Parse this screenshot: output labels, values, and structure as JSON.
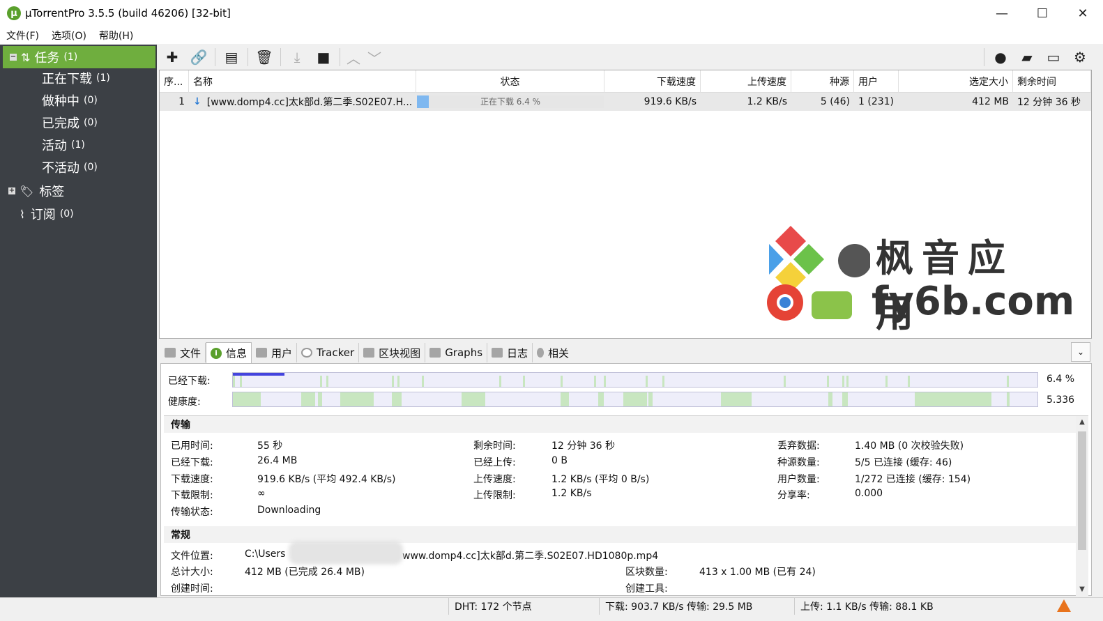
{
  "window": {
    "title": "µTorrentPro 3.5.5  (build 46206) [32-bit]",
    "app_icon_glyph": "µ",
    "minimize_glyph": "—",
    "maximize_glyph": "☐",
    "close_glyph": "✕"
  },
  "menu": [
    "文件(F)",
    "选项(O)",
    "帮助(H)"
  ],
  "sidebar": {
    "tasks": {
      "label": "任务",
      "count": "(1)"
    },
    "items": [
      {
        "label": "正在下载",
        "count": "(1)"
      },
      {
        "label": "做种中",
        "count": "(0)"
      },
      {
        "label": "已完成",
        "count": "(0)"
      },
      {
        "label": "活动",
        "count": "(1)"
      },
      {
        "label": "不活动",
        "count": "(0)"
      }
    ],
    "labels": {
      "label": "标签"
    },
    "feeds": {
      "label": "订阅",
      "count": "(0)"
    }
  },
  "toolbar": {
    "icons": {
      "add": "plus-icon",
      "add_link": "link-icon",
      "create": "new-torrent-icon",
      "remove": "trash-icon",
      "start": "download-icon",
      "stop": "stop-icon",
      "up": "chevron-up-icon",
      "down": "chevron-down-icon",
      "bulb": "bulb-icon",
      "chat": "chat-icon",
      "remote": "monitor-icon",
      "settings": "gear-icon"
    }
  },
  "list": {
    "columns": [
      "序...",
      "名称",
      "状态",
      "下载速度",
      "上传速度",
      "种源",
      "用户",
      "选定大小",
      "剩余时间"
    ],
    "rows": [
      {
        "index": "1",
        "name": "[www.domp4.cc]太k部d.第二季.S02E07.H...",
        "status": "正在下载 6.4 %",
        "progress": 0.064,
        "down_speed": "919.6 KB/s",
        "up_speed": "1.2 KB/s",
        "seeds": "5 (46)",
        "peers": "1 (231)",
        "size": "412 MB",
        "eta": "12 分钟 36 秒"
      }
    ]
  },
  "watermark": {
    "line1": "枫音应用",
    "line2": "fy6b.com"
  },
  "tabs": [
    "文件",
    "信息",
    "用户",
    "Tracker",
    "区块视图",
    "Graphs",
    "日志",
    "相关"
  ],
  "progress": {
    "downloaded_label": "已经下载:",
    "downloaded_value": "6.4 %",
    "health_label": "健康度:",
    "health_value": "5.336"
  },
  "transfer": {
    "heading": "传输",
    "fields": [
      {
        "k": "已用时间:",
        "v": "55 秒"
      },
      {
        "k": "已经下载:",
        "v": "26.4 MB"
      },
      {
        "k": "下载速度:",
        "v": "919.6 KB/s (平均 492.4 KB/s)"
      },
      {
        "k": "下载限制:",
        "v": "∞"
      },
      {
        "k": "传输状态:",
        "v": "Downloading"
      },
      {
        "k": "剩余时间:",
        "v": "12 分钟 36 秒"
      },
      {
        "k": "已经上传:",
        "v": "0 B"
      },
      {
        "k": "上传速度:",
        "v": "1.2 KB/s (平均 0 B/s)"
      },
      {
        "k": "上传限制:",
        "v": "1.2 KB/s"
      },
      {
        "k": "丢弃数据:",
        "v": "1.40 MB (0 次校验失败)"
      },
      {
        "k": "种源数量:",
        "v": "5/5 已连接 (缓存: 46)"
      },
      {
        "k": "用户数量:",
        "v": "1/272 已连接 (缓存: 154)"
      },
      {
        "k": "分享率:",
        "v": "0.000"
      }
    ]
  },
  "general": {
    "heading": "常规",
    "save_path_label": "文件位置:",
    "save_path_start": "C:\\Users",
    "save_path_end": "www.domp4.cc]太k部d.第二季.S02E07.HD1080p.mp4",
    "total_size_label": "总计大小:",
    "total_size": "412 MB (已完成 26.4 MB)",
    "created_label": "创建时间:",
    "pieces_label": "区块数量:",
    "pieces": "413 x 1.00 MB (已有 24)",
    "creator_label": "创建工具:"
  },
  "statusbar": {
    "dht": "DHT: 172 个节点",
    "down": "下载: 903.7 KB/s 传输: 29.5 MB",
    "up": "上传: 1.1 KB/s 传输: 88.1 KB"
  },
  "colors": {
    "accent": "#6fae3e",
    "sidebar": "#3c4045",
    "progress": "#7fb8f0",
    "health": "#c8e6c0"
  }
}
